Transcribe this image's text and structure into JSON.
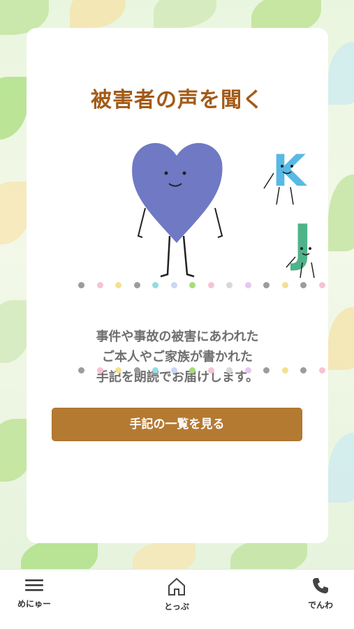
{
  "page": {
    "title": "被害者の声を聞く",
    "description": [
      "事件や事故の被害にあわれた",
      "ご本人やご家族が書かれた",
      "手記を朗読でお届けします。"
    ],
    "cta_label": "手記の一覧を見る"
  },
  "illustration": {
    "letters": [
      "K",
      "J"
    ]
  },
  "colors": {
    "title": "#a35a17",
    "button": "#b47a32",
    "heart": "#6f79c4",
    "k_letter": "#58b9e4",
    "j_letter": "#4fb38a"
  },
  "dot_colors": [
    "#9c9c9c",
    "#f7c3cf",
    "#f4e08f",
    "#9c9c9c",
    "#92dde3",
    "#c9d8f0",
    "#a8db7c",
    "#f7c3cf",
    "#d8d8d8",
    "#e7c7f0",
    "#9c9c9c",
    "#f4e08f",
    "#9c9c9c",
    "#f7c3cf"
  ],
  "tabbar": {
    "items": [
      {
        "label": "めにゅー",
        "icon": "menu-icon"
      },
      {
        "label": "とっぷ",
        "icon": "home-icon"
      },
      {
        "label": "でんわ",
        "icon": "phone-icon"
      }
    ]
  }
}
